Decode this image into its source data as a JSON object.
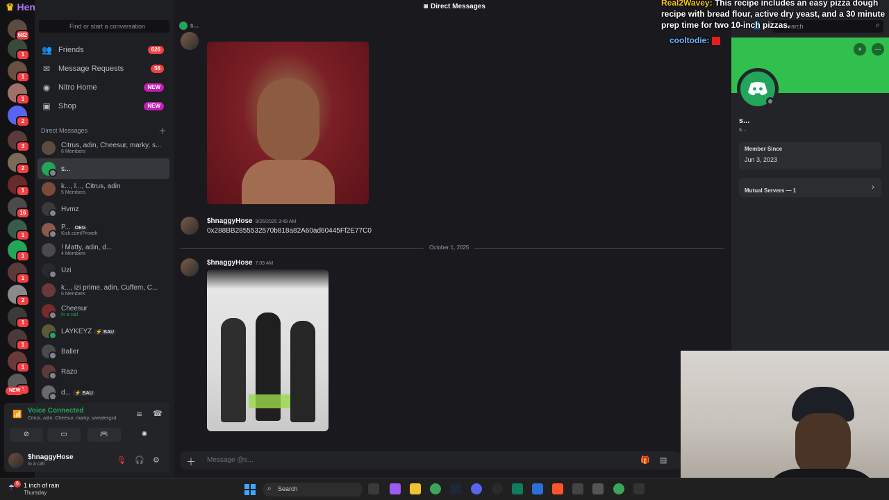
{
  "stream": {
    "streamer_name": "Henry",
    "chat": [
      {
        "user": "Real2Wavey:",
        "text": "This recipe includes an easy pizza dough recipe with bread flour, active dry yeast, and a 30 minute prep time for two 10-inch pizzas."
      },
      {
        "user": "cooltodie:",
        "text": ""
      }
    ]
  },
  "rail": {
    "top_badge": "682",
    "badges": [
      "1",
      "1",
      "1",
      "2",
      "3",
      "2",
      "1",
      "16",
      "1",
      "1",
      "1",
      "2",
      "1",
      "1",
      "1",
      "1"
    ],
    "new_label": "NEW"
  },
  "sidebar": {
    "search_placeholder": "Find or start a conversation",
    "nav": [
      {
        "label": "Friends",
        "pill": "626"
      },
      {
        "label": "Message Requests",
        "pill": "56"
      },
      {
        "label": "Nitro Home",
        "pill": "NEW"
      },
      {
        "label": "Shop",
        "pill": "NEW"
      }
    ],
    "dm_header": "Direct Messages",
    "dms": [
      {
        "name": "Citrus, adin, Cheesur, marky, s...",
        "sub": "6 Members"
      },
      {
        "name": "s...",
        "sub": ""
      },
      {
        "name": "k..., l..., Citrus, adin",
        "sub": "5 Members"
      },
      {
        "name": "Hvmz",
        "sub": ""
      },
      {
        "name": "P...",
        "tag": "OEG",
        "sub": "Kick.com/Proxeh"
      },
      {
        "name": "! Matty, adin, d...",
        "sub": "4 Members"
      },
      {
        "name": "Uzi",
        "sub": ""
      },
      {
        "name": "k..., izi prime, adin, Cuffem, C...",
        "sub": "6 Members"
      },
      {
        "name": "Cheesur",
        "sub": "In a call"
      },
      {
        "name": "LAYKEYZ",
        "tag": "⚡ BAU",
        "sub": ""
      },
      {
        "name": "Baller",
        "sub": ""
      },
      {
        "name": "Razo",
        "sub": ""
      },
      {
        "name": "d...",
        "tag": "⚡ BAU",
        "sub": ""
      }
    ],
    "voice": {
      "title": "Voice Connected",
      "members": "Citrus, adin, Cheesur, marky, sweatergxd"
    },
    "user": {
      "name": "$hnaggyHose",
      "status": "In a call"
    }
  },
  "chat": {
    "title": "Direct Messages",
    "channel_chip": "s...",
    "messages": [
      {
        "author": "$hnaggyHose",
        "time": "9/26/2025 3:49 AM",
        "text": "0x288BB2855532570b818a82A60ad60445Ff2E77C0"
      },
      {
        "author": "$hnaggyHose",
        "time": "7:09 AM",
        "text": ""
      }
    ],
    "date_divider": "October 1, 2025",
    "composer_placeholder": "Message @s..."
  },
  "profile": {
    "search_placeholder": "Search",
    "name": "s...",
    "username": "s...",
    "member_since_label": "Member Since",
    "member_since_value": "Jun 3, 2023",
    "mutual_servers": "Mutual Servers — 1"
  },
  "taskbar": {
    "weather_badge": "6",
    "weather_title": "1 inch of rain",
    "weather_day": "Thursday",
    "search_label": "Search"
  },
  "colors": {
    "accent_green": "#23a55a",
    "danger_red": "#f23f43",
    "nitro_pink": "#c51cb7",
    "banner_green": "#31bf4d"
  }
}
